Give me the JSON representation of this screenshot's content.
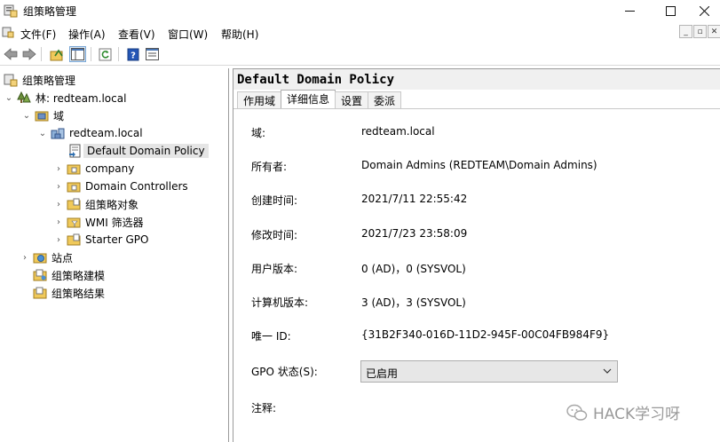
{
  "window": {
    "title": "组策略管理"
  },
  "menu": {
    "items": [
      "文件(F)",
      "操作(A)",
      "查看(V)",
      "窗口(W)",
      "帮助(H)"
    ]
  },
  "tree": {
    "root": "组策略管理",
    "forest": "林: redteam.local",
    "domains": "域",
    "domain": "redteam.local",
    "gpo_selected": "Default Domain Policy",
    "children": [
      "company",
      "Domain Controllers",
      "组策略对象",
      "WMI 筛选器",
      "Starter GPO"
    ],
    "sites": "站点",
    "modeling": "组策略建模",
    "results": "组策略结果"
  },
  "details": {
    "header": "Default Domain Policy",
    "tabs": [
      "作用域",
      "详细信息",
      "设置",
      "委派"
    ],
    "active_tab": "详细信息",
    "fields": [
      {
        "label": "域:",
        "value": "redteam.local"
      },
      {
        "label": "所有者:",
        "value": "Domain Admins (REDTEAM\\Domain Admins)"
      },
      {
        "label": "创建时间:",
        "value": "2021/7/11 22:55:42"
      },
      {
        "label": "修改时间:",
        "value": "2021/7/23 23:58:09"
      },
      {
        "label": "用户版本:",
        "value": "0 (AD)，0 (SYSVOL)"
      },
      {
        "label": "计算机版本:",
        "value": "3 (AD)，3 (SYSVOL)"
      },
      {
        "label": "唯一 ID:",
        "value": "{31B2F340-016D-11D2-945F-00C04FB984F9}"
      }
    ],
    "gpo_status_label": "GPO 状态(S):",
    "gpo_status_value": "已启用",
    "comment_label": "注释:"
  },
  "watermark": {
    "text": "HACK学习呀"
  },
  "icons": {
    "window_controls": [
      "minimize-icon",
      "maximize-icon",
      "close-icon"
    ],
    "toolbar": [
      "back-arrow-icon",
      "forward-arrow-icon",
      "up-folder-icon",
      "show-hide-tree-icon",
      "refresh-icon",
      "help-icon",
      "properties-icon"
    ]
  }
}
